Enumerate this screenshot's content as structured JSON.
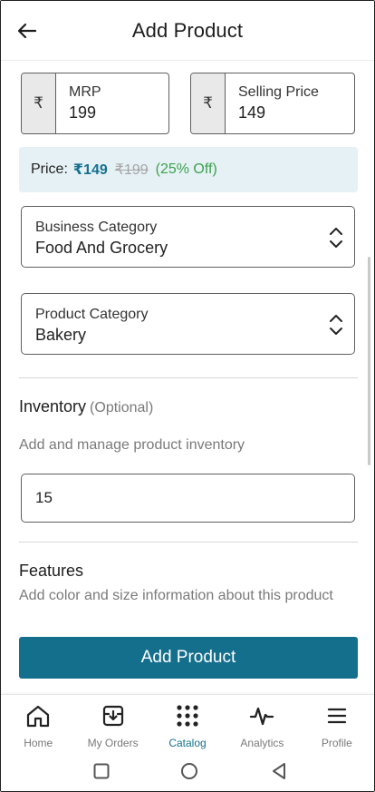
{
  "header": {
    "title": "Add Product"
  },
  "pricing": {
    "currency_symbol": "₹",
    "mrp": {
      "label": "MRP",
      "value": "199"
    },
    "selling": {
      "label": "Selling Price",
      "value": "149"
    }
  },
  "summary": {
    "label": "Price:",
    "selling_price": "₹149",
    "mrp": "₹199",
    "discount": "(25% Off)"
  },
  "business_category": {
    "label": "Business Category",
    "value": "Food And Grocery"
  },
  "product_category": {
    "label": "Product Category",
    "value": "Bakery"
  },
  "inventory": {
    "title": "Inventory",
    "optional": "(Optional)",
    "description": "Add and manage product inventory",
    "value": "15"
  },
  "features": {
    "title": "Features",
    "description": "Add color and size information about this product"
  },
  "primary_button": "Add Product",
  "bottom_nav": {
    "active": "catalog",
    "items": [
      {
        "id": "home",
        "label": "Home",
        "icon": "home-icon"
      },
      {
        "id": "orders",
        "label": "My Orders",
        "icon": "orders-box-icon"
      },
      {
        "id": "catalog",
        "label": "Catalog",
        "icon": "grid-dots-icon"
      },
      {
        "id": "analytics",
        "label": "Analytics",
        "icon": "pulse-icon"
      },
      {
        "id": "profile",
        "label": "Profile",
        "icon": "menu-icon"
      }
    ]
  },
  "colors": {
    "accent": "#146f8d",
    "summary_bg": "#e6f1f6",
    "discount_green": "#3aa24b",
    "nav_inactive": "#7a7a7a"
  }
}
